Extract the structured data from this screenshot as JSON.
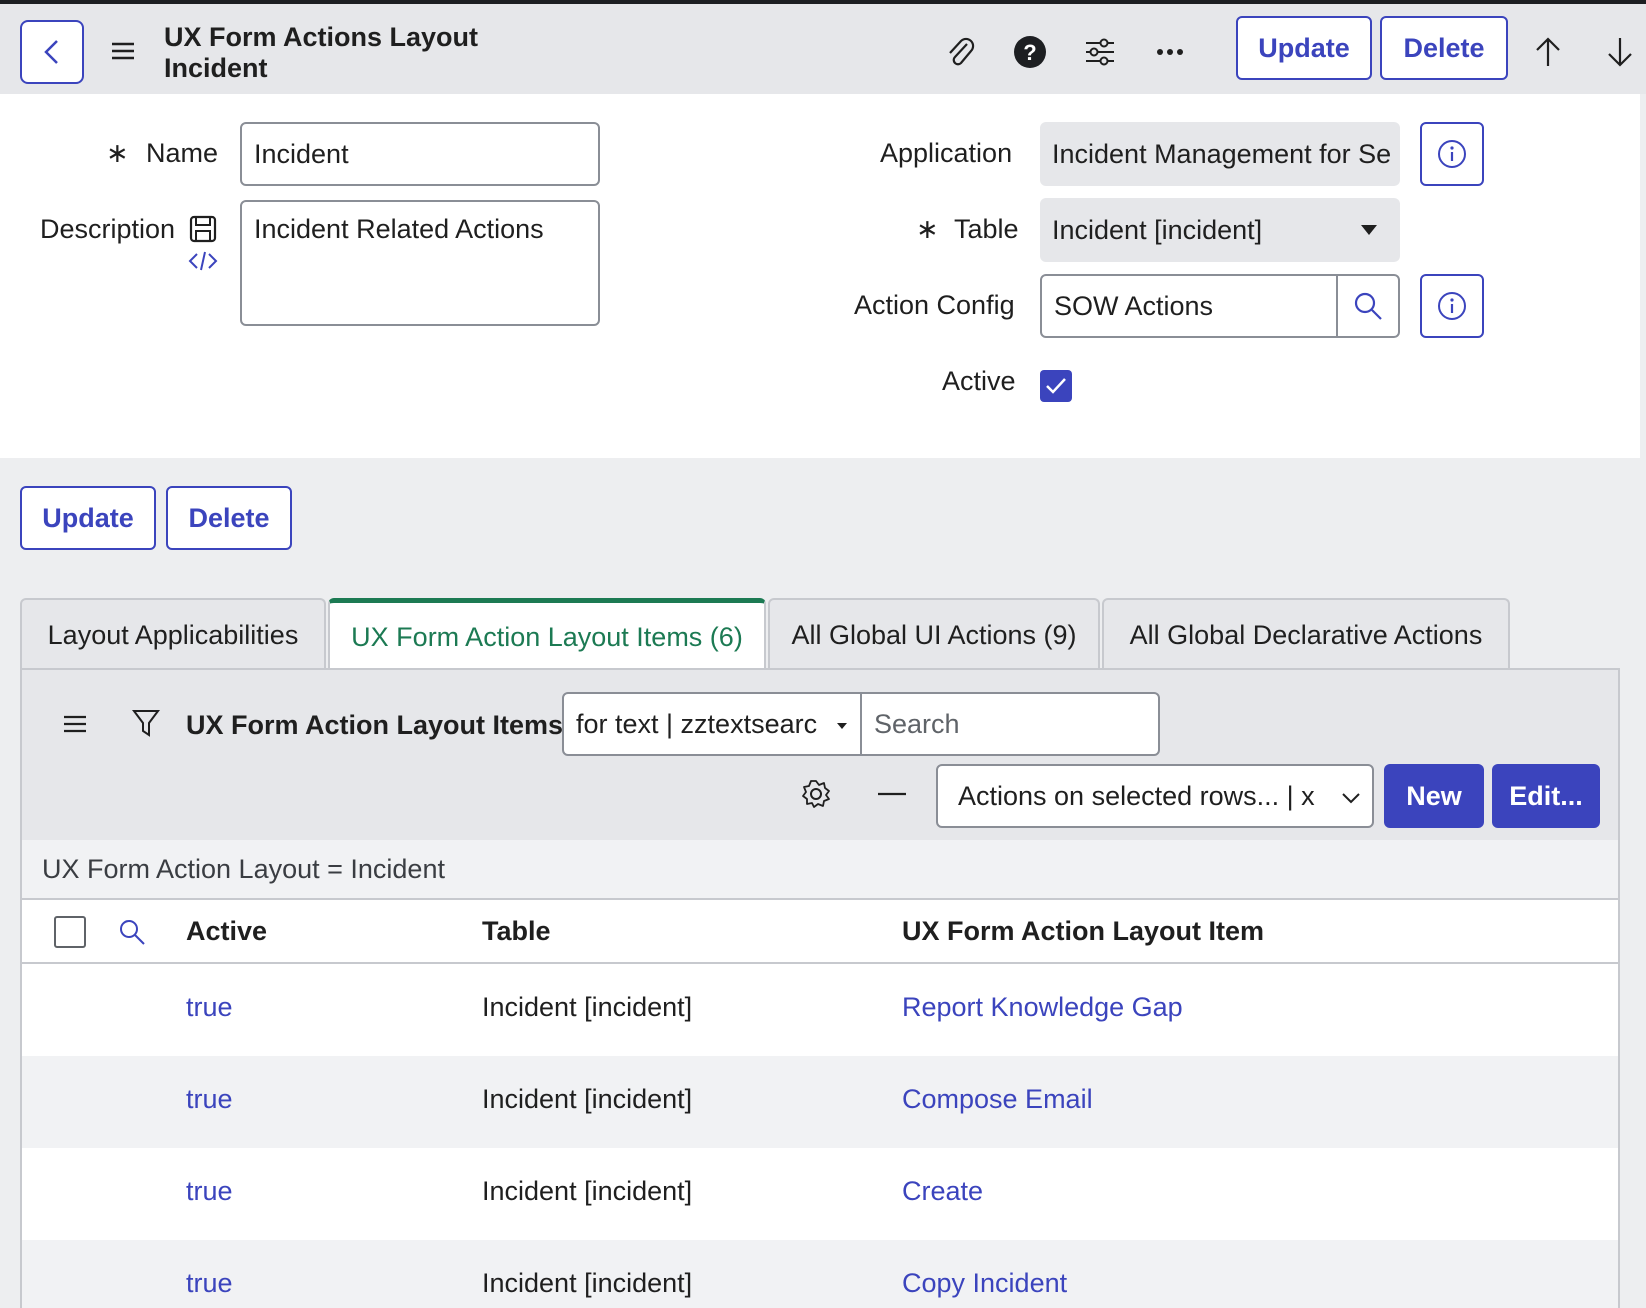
{
  "header": {
    "title_line1": "UX Form Actions Layout",
    "title_line2": "Incident",
    "update_label": "Update",
    "delete_label": "Delete"
  },
  "form": {
    "name_label": "Name",
    "name_value": "Incident",
    "description_label": "Description",
    "description_value": "Incident Related Actions",
    "application_label": "Application",
    "application_value": "Incident Management for Se",
    "table_label": "Table",
    "table_value": "Incident [incident]",
    "action_config_label": "Action Config",
    "action_config_value": "SOW Actions",
    "active_label": "Active",
    "active_checked": true,
    "required_marker": "∗"
  },
  "bottom_buttons": {
    "update_label": "Update",
    "delete_label": "Delete"
  },
  "tabs": [
    {
      "label": "Layout Applicabilities"
    },
    {
      "label": "UX Form Action Layout Items (6)"
    },
    {
      "label": "All Global UI Actions (9)"
    },
    {
      "label": "All Global Declarative Actions"
    }
  ],
  "list": {
    "title": "UX Form Action Layout Items",
    "search_field": "for text | zztextsearc",
    "search_placeholder": "Search",
    "actions_select": "Actions on selected rows... | x",
    "new_label": "New",
    "edit_label": "Edit...",
    "breadcrumb": "UX Form Action Layout = Incident",
    "columns": [
      "Active",
      "Table",
      "UX Form Action Layout Item"
    ],
    "rows": [
      {
        "active": "true",
        "table": "Incident [incident]",
        "item": "Report Knowledge Gap"
      },
      {
        "active": "true",
        "table": "Incident [incident]",
        "item": "Compose Email"
      },
      {
        "active": "true",
        "table": "Incident [incident]",
        "item": "Create"
      },
      {
        "active": "true",
        "table": "Incident [incident]",
        "item": "Copy Incident"
      }
    ]
  },
  "colors": {
    "accent": "#3b44bd",
    "active_tab": "#1c7a53",
    "header_bg": "#e6e7ea"
  }
}
